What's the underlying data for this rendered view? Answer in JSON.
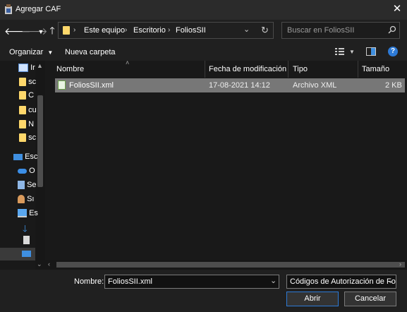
{
  "window": {
    "title": "Agregar CAF"
  },
  "nav": {
    "breadcrumb": [
      "Este equipo",
      "Escritorio",
      "FoliosSII"
    ],
    "search_placeholder": "Buscar en FoliosSII"
  },
  "toolbar": {
    "organize_label": "Organizar",
    "new_folder_label": "Nueva carpeta"
  },
  "sidebar": {
    "items": [
      {
        "label": "Ir",
        "icon": "document-icon"
      },
      {
        "label": "sc",
        "icon": "folder-icon"
      },
      {
        "label": "C",
        "icon": "folder-icon"
      },
      {
        "label": "cu",
        "icon": "folder-icon"
      },
      {
        "label": "N",
        "icon": "folder-icon"
      },
      {
        "label": "sc",
        "icon": "folder-icon"
      },
      {
        "label": "Esc",
        "icon": "desktop-icon"
      },
      {
        "label": "O",
        "icon": "onedrive-icon"
      },
      {
        "label": "Se",
        "icon": "building-icon"
      },
      {
        "label": "Sı",
        "icon": "user-icon"
      },
      {
        "label": "Es",
        "icon": "computer-icon"
      }
    ]
  },
  "columns": [
    "Nombre",
    "Fecha de modificación",
    "Tipo",
    "Tamaño"
  ],
  "files": [
    {
      "name": "FoliosSII.xml",
      "modified": "17-08-2021 14:12",
      "type": "Archivo XML",
      "size": "2 KB"
    }
  ],
  "bottom": {
    "filename_label": "Nombre:",
    "filename_value": "FoliosSII.xml",
    "filetype_value": "Códigos de Autorización de Fol",
    "open_label": "Abrir",
    "cancel_label": "Cancelar"
  },
  "colors": {
    "accent": "#2d7ad6",
    "selection": "#777777",
    "background": "#202020"
  }
}
